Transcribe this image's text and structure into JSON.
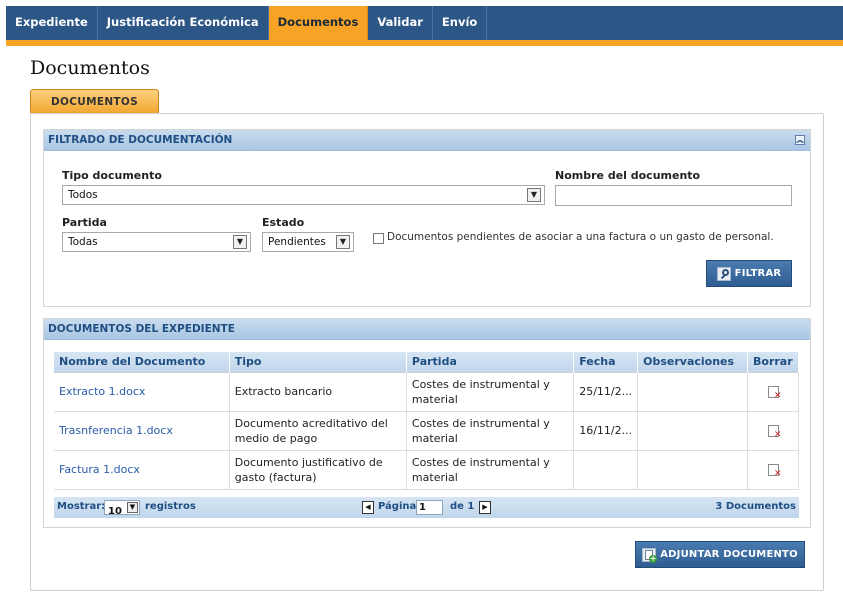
{
  "nav": {
    "tabs": [
      {
        "label": "Expediente"
      },
      {
        "label": "Justificación Económica"
      },
      {
        "label": "Documentos",
        "active": true
      },
      {
        "label": "Validar"
      },
      {
        "label": "Envío"
      }
    ]
  },
  "page": {
    "title": "Documentos",
    "section_tab": "DOCUMENTOS"
  },
  "filter": {
    "header": "FILTRADO DE DOCUMENTACIÓN",
    "tipo_label": "Tipo documento",
    "tipo_value": "Todos",
    "nombre_label": "Nombre del documento",
    "nombre_value": "",
    "partida_label": "Partida",
    "partida_value": "Todas",
    "estado_label": "Estado",
    "estado_value": "Pendientes",
    "checkbox_label": "Documentos pendientes de asociar a una factura o un gasto de personal.",
    "checkbox_checked": false,
    "filter_button": "FILTRAR"
  },
  "documents": {
    "header": "DOCUMENTOS DEL EXPEDIENTE",
    "columns": [
      "Nombre del Documento",
      "Tipo",
      "Partida",
      "Fecha",
      "Observaciones",
      "Borrar"
    ],
    "rows": [
      {
        "nombre": "Extracto 1.docx",
        "tipo": "Extracto bancario",
        "partida": "Costes de instrumental y material",
        "fecha": "25/11/2...",
        "observaciones": ""
      },
      {
        "nombre": "Trasnferencia 1.docx",
        "tipo": "Documento acreditativo del medio de pago",
        "partida": "Costes de instrumental y material",
        "fecha": "16/11/2...",
        "observaciones": ""
      },
      {
        "nombre": "Factura 1.docx",
        "tipo": "Documento justificativo de gasto (factura)",
        "partida": "Costes de instrumental y material",
        "fecha": "",
        "observaciones": ""
      }
    ],
    "pager": {
      "show_label": "Mostrar:",
      "page_size": "10",
      "records_label": "registros",
      "page_label": "Página",
      "page_value": "1",
      "of_label": "de 1",
      "total": "3 Documentos"
    },
    "attach_button": "ADJUNTAR DOCUMENTO"
  },
  "colors": {
    "nav_bg": "#2c5686",
    "accent_orange": "#f6a326",
    "header_blue": "#1f4e83",
    "link_blue": "#2a5ca8"
  }
}
